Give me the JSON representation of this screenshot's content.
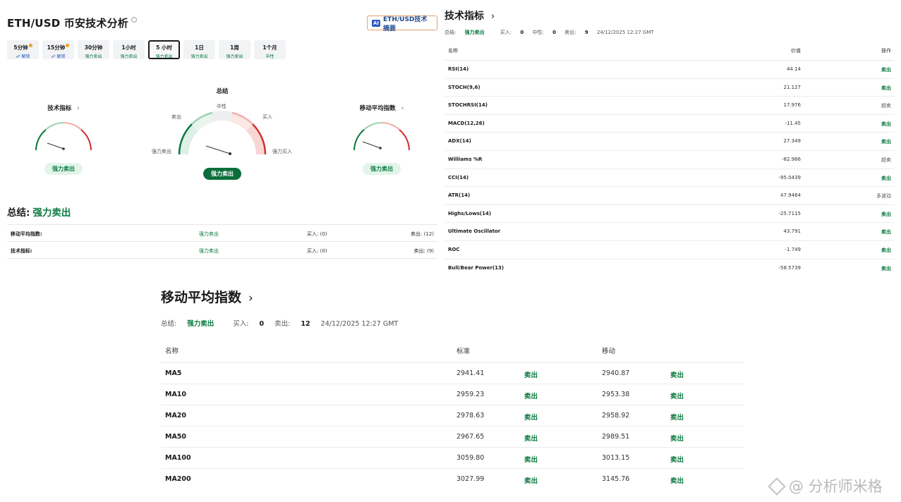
{
  "header": {
    "title": "ETH/USD 币安技术分析",
    "ai_button_badge": "AI",
    "ai_button_label": "ETH/USD技术摘要"
  },
  "timeframes": [
    {
      "label": "5分钟",
      "sub": "解锁",
      "locked": true
    },
    {
      "label": "15分钟",
      "sub": "解锁",
      "locked": true
    },
    {
      "label": "30分钟",
      "sub": "强力卖出"
    },
    {
      "label": "1小时",
      "sub": "强力卖出"
    },
    {
      "label": "5 小时",
      "sub": "强力卖出",
      "active": true
    },
    {
      "label": "1日",
      "sub": "强力卖出"
    },
    {
      "label": "1周",
      "sub": "强力卖出"
    },
    {
      "label": "1个月",
      "sub": "中性"
    }
  ],
  "gauges": {
    "summary_title": "总结",
    "summary_result": "强力卖出",
    "technical_title": "技术指标",
    "technical_result": "强力卖出",
    "ma_title": "移动平均指数",
    "ma_result": "强力卖出",
    "chevron": "›",
    "labels": {
      "neutral": "中性",
      "sell": "卖出",
      "buy": "买入",
      "strong_sell": "强力卖出",
      "strong_buy": "强力买入"
    }
  },
  "summary": {
    "label": "总结:",
    "result": "强力卖出",
    "rows": [
      {
        "name": "移动平均指数:",
        "result": "强力卖出",
        "buy": "买入: (0)",
        "sell": "卖出: (12)"
      },
      {
        "name": "技术指标:",
        "result": "强力卖出",
        "buy": "买入: (0)",
        "sell": "卖出: (9)"
      }
    ]
  },
  "technical": {
    "title": "技术指标",
    "chevron": "›",
    "summary_label": "总结:",
    "summary_result": "强力卖出",
    "buy_label": "买入:",
    "buy_count": "0",
    "neutral_label": "中性:",
    "neutral_count": "0",
    "sell_label": "卖出:",
    "sell_count": "9",
    "timestamp": "24/12/2025 12:27 GMT",
    "columns": [
      "名称",
      "价值",
      "操作"
    ],
    "rows": [
      {
        "name": "RSI(14)",
        "value": "44.14",
        "action": "卖出"
      },
      {
        "name": "STOCH(9,6)",
        "value": "21.127",
        "action": "卖出"
      },
      {
        "name": "STOCHRSI(14)",
        "value": "17.976",
        "action": "超卖"
      },
      {
        "name": "MACD(12,26)",
        "value": "-11.45",
        "action": "卖出"
      },
      {
        "name": "ADX(14)",
        "value": "27.349",
        "action": "卖出"
      },
      {
        "name": "Williams %R",
        "value": "-82.966",
        "action": "超卖"
      },
      {
        "name": "CCI(14)",
        "value": "-95.0439",
        "action": "卖出"
      },
      {
        "name": "ATR(14)",
        "value": "47.9464",
        "action": "多波动"
      },
      {
        "name": "Highs/Lows(14)",
        "value": "-25.7115",
        "action": "卖出"
      },
      {
        "name": "Ultimate Oscillator",
        "value": "43.791",
        "action": "卖出"
      },
      {
        "name": "ROC",
        "value": "-1.749",
        "action": "卖出"
      },
      {
        "name": "Bull/Bear Power(13)",
        "value": "-58.5739",
        "action": "卖出"
      }
    ]
  },
  "moving_averages": {
    "title": "移动平均指数",
    "chevron": "›",
    "summary_label": "总结:",
    "summary_result": "强力卖出",
    "buy_label": "买入:",
    "buy_count": "0",
    "sell_label": "卖出:",
    "sell_count": "12",
    "timestamp": "24/12/2025 12:27 GMT",
    "columns": [
      "名称",
      "标准",
      "移动"
    ],
    "rows": [
      {
        "name": "MA5",
        "simple": "2941.41",
        "simple_action": "卖出",
        "exp": "2940.87",
        "exp_action": "卖出"
      },
      {
        "name": "MA10",
        "simple": "2959.23",
        "simple_action": "卖出",
        "exp": "2953.38",
        "exp_action": "卖出"
      },
      {
        "name": "MA20",
        "simple": "2978.63",
        "simple_action": "卖出",
        "exp": "2958.92",
        "exp_action": "卖出"
      },
      {
        "name": "MA50",
        "simple": "2967.65",
        "simple_action": "卖出",
        "exp": "2989.51",
        "exp_action": "卖出"
      },
      {
        "name": "MA100",
        "simple": "3059.80",
        "simple_action": "卖出",
        "exp": "3013.15",
        "exp_action": "卖出"
      },
      {
        "name": "MA200",
        "simple": "3027.99",
        "simple_action": "卖出",
        "exp": "3145.76",
        "exp_action": "卖出"
      }
    ]
  },
  "watermark": "@ 分析师米格",
  "colors": {
    "sell_green": "#0a7a3e",
    "buy_red": "#d0312d",
    "accent_blue": "#2b59c3"
  }
}
